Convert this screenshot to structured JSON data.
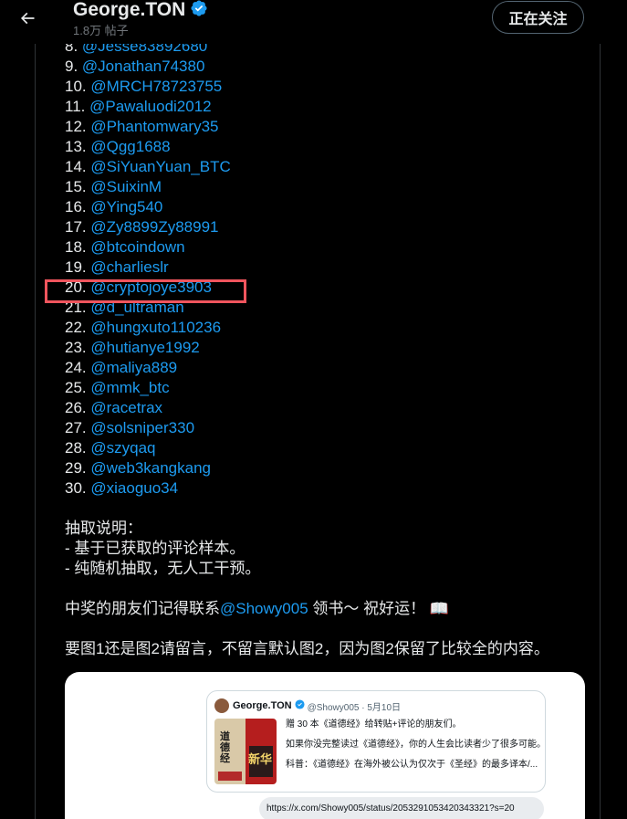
{
  "header": {
    "title": "George.TON",
    "post_count": "1.8万 帖子",
    "follow_label": "正在关注",
    "icons": [
      "back-arrow-icon",
      "verified-badge-icon"
    ]
  },
  "winners": [
    {
      "num": "8.",
      "handle": "@Jesse83892680"
    },
    {
      "num": "9.",
      "handle": "@Jonathan74380"
    },
    {
      "num": "10.",
      "handle": "@MRCH78723755"
    },
    {
      "num": "11.",
      "handle": "@Pawaluodi2012"
    },
    {
      "num": "12.",
      "handle": "@Phantomwary35"
    },
    {
      "num": "13.",
      "handle": "@Qgg1688"
    },
    {
      "num": "14.",
      "handle": "@SiYuanYuan_BTC"
    },
    {
      "num": "15.",
      "handle": "@SuixinM"
    },
    {
      "num": "16.",
      "handle": "@Ying540"
    },
    {
      "num": "17.",
      "handle": "@Zy8899Zy88991"
    },
    {
      "num": "18.",
      "handle": "@btcoindown"
    },
    {
      "num": "19.",
      "handle": "@charlieslr"
    },
    {
      "num": "20.",
      "handle": "@cryptojoye3903"
    },
    {
      "num": "21.",
      "handle": "@d_ultraman"
    },
    {
      "num": "22.",
      "handle": "@hungxuto110236"
    },
    {
      "num": "23.",
      "handle": "@hutianye1992"
    },
    {
      "num": "24.",
      "handle": "@maliya889"
    },
    {
      "num": "25.",
      "handle": "@mmk_btc"
    },
    {
      "num": "26.",
      "handle": "@racetrax"
    },
    {
      "num": "27.",
      "handle": "@solsniper330"
    },
    {
      "num": "28.",
      "handle": "@szyqaq"
    },
    {
      "num": "29.",
      "handle": "@web3kangkang"
    },
    {
      "num": "30.",
      "handle": "@xiaoguo34"
    }
  ],
  "notes": {
    "heading": "抽取说明：",
    "line1": "- 基于已获取的评论样本。",
    "line2": "- 纯随机抽取，无人工干预。"
  },
  "contact": {
    "prefix": "中奖的朋友们记得联系",
    "mention": "@Showy005",
    "suffix": " 领书～ 祝好运！ 📖"
  },
  "request": "要图1还是图2请留言，不留言默认图2，因为图2保留了比较全的内容。",
  "embedded": {
    "name": "George.TON",
    "meta": "@Showy005 · 5月10日",
    "line1": "赠 30 本《道德经》给转贴+评论的朋友们。",
    "line2": "如果你没完整读过《道德经》，你的人生会比读者少了很多可能。",
    "line3": "科普：《道德经》在海外被公认为仅次于《圣经》的最多译本/...",
    "book_left": "道德经",
    "book_right": "新华",
    "url": "https://x.com/Showy005/status/2053291053420343321?s=20"
  },
  "colors": {
    "background": "#000000",
    "text": "#e7e9ea",
    "link": "#1d9bf0",
    "highlight": "#f0555d"
  }
}
